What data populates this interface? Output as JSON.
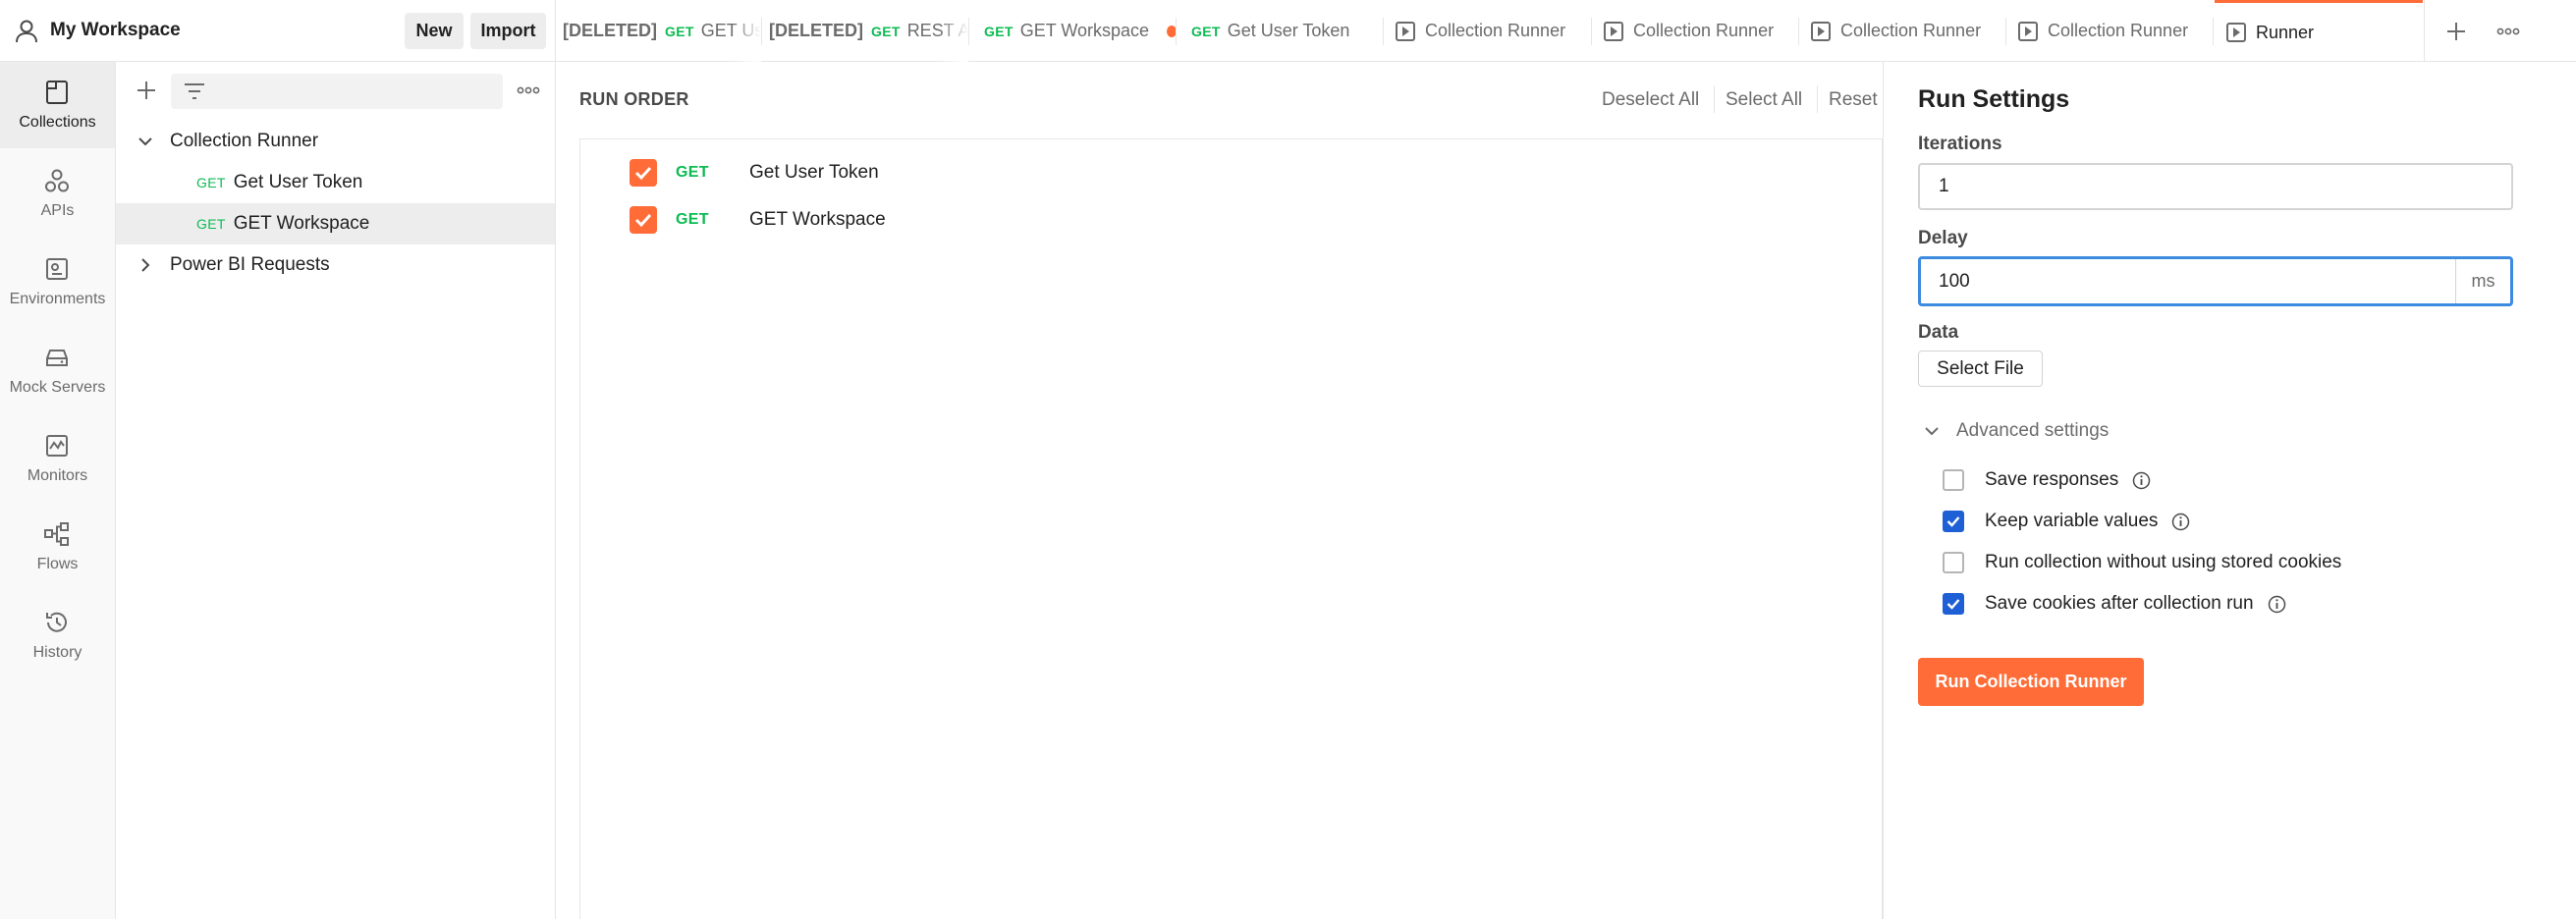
{
  "workspace": {
    "title": "My Workspace",
    "new_label": "New",
    "import_label": "Import"
  },
  "tabs": [
    {
      "prefix": "[DELETED]",
      "method": "GET",
      "name": "GET User Token"
    },
    {
      "prefix": "[DELETED]",
      "method": "GET",
      "name": "REST API"
    },
    {
      "prefix": "",
      "method": "GET",
      "name": "GET Workspace",
      "unsaved": true
    },
    {
      "prefix": "",
      "method": "GET",
      "name": "Get User Token"
    },
    {
      "name": "Collection Runner"
    },
    {
      "name": "Collection Runner"
    },
    {
      "name": "Collection Runner"
    },
    {
      "name": "Collection Runner"
    },
    {
      "name": "Runner",
      "active": true
    }
  ],
  "nav": [
    {
      "label": "Collections",
      "icon": "collections-icon",
      "active": true
    },
    {
      "label": "APIs",
      "icon": "apis-icon"
    },
    {
      "label": "Environments",
      "icon": "environments-icon"
    },
    {
      "label": "Mock Servers",
      "icon": "mock-servers-icon"
    },
    {
      "label": "Monitors",
      "icon": "monitors-icon"
    },
    {
      "label": "Flows",
      "icon": "flows-icon"
    },
    {
      "label": "History",
      "icon": "history-icon"
    }
  ],
  "tree": {
    "collections": [
      {
        "name": "Collection Runner",
        "expanded": true,
        "requests": [
          {
            "method": "GET",
            "name": "Get User Token"
          },
          {
            "method": "GET",
            "name": "GET Workspace",
            "selected": true
          }
        ]
      },
      {
        "name": "Power BI Requests",
        "expanded": false
      }
    ]
  },
  "run_order": {
    "title": "RUN ORDER",
    "deselect_all": "Deselect All",
    "select_all": "Select All",
    "reset": "Reset",
    "requests": [
      {
        "method": "GET",
        "name": "Get User Token",
        "checked": true
      },
      {
        "method": "GET",
        "name": "GET Workspace",
        "checked": true
      }
    ]
  },
  "settings": {
    "title": "Run Settings",
    "iterations_label": "Iterations",
    "iterations_value": "1",
    "delay_label": "Delay",
    "delay_value": "100",
    "delay_unit": "ms",
    "data_label": "Data",
    "select_file": "Select File",
    "advanced_label": "Advanced settings",
    "options": [
      {
        "label": "Save responses",
        "checked": false,
        "info": true
      },
      {
        "label": "Keep variable values",
        "checked": true,
        "info": true
      },
      {
        "label": "Run collection without using stored cookies",
        "checked": false,
        "info": false
      },
      {
        "label": "Save cookies after collection run",
        "checked": true,
        "info": true
      }
    ],
    "run_button": "Run Collection Runner"
  },
  "colors": {
    "accent": "#ff6c37",
    "get_method": "#0cbb52",
    "checkbox_blue": "#1f5fd6",
    "focus_blue": "#3d8be0"
  }
}
